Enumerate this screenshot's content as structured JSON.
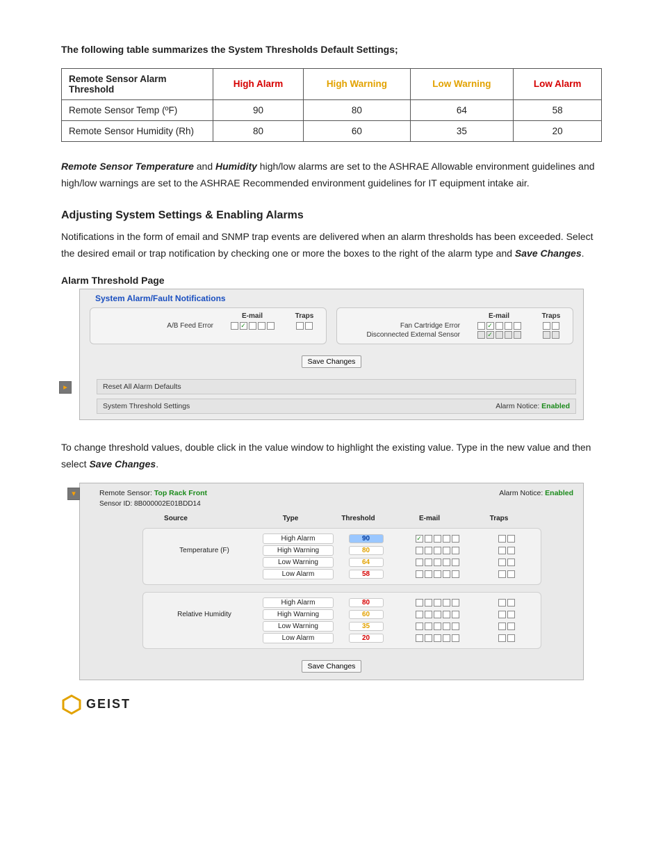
{
  "intro_line": "The following table summarizes the System Thresholds Default Settings;",
  "summary_table": {
    "headers": [
      "Remote Sensor Alarm Threshold",
      "High Alarm",
      "High Warning",
      "Low Warning",
      "Low Alarm"
    ],
    "rows": [
      {
        "label": "Remote Sensor Temp (ºF)",
        "ha": "90",
        "hw": "80",
        "lw": "64",
        "la": "58"
      },
      {
        "label": "Remote Sensor Humidity (Rh)",
        "ha": "80",
        "hw": "60",
        "lw": "35",
        "la": "20"
      }
    ]
  },
  "chart_data": {
    "type": "table",
    "title": "System Thresholds Default Settings",
    "columns": [
      "Remote Sensor Alarm Threshold",
      "High Alarm",
      "High Warning",
      "Low Warning",
      "Low Alarm"
    ],
    "rows": [
      [
        "Remote Sensor Temp (ºF)",
        90,
        80,
        64,
        58
      ],
      [
        "Remote Sensor Humidity (Rh)",
        80,
        60,
        35,
        20
      ]
    ]
  },
  "para1": {
    "b1": "Remote Sensor Temperature",
    "mid": " and ",
    "b2": "Humidity",
    "rest": " high/low alarms are set to the ASHRAE Allowable environment guidelines and high/low warnings are set to the ASHRAE Recommended environment guidelines for IT equipment intake air."
  },
  "section_heading": "Adjusting System Settings & Enabling Alarms",
  "para2": {
    "text": "Notifications in the form of email and SNMP trap events are delivered when an alarm thresholds has been exceeded.  Select the desired email or trap notification by checking one or more the boxes to the right of the alarm type and ",
    "b": "Save Changes",
    "tail": "."
  },
  "sub_heading": "Alarm Threshold Page",
  "notif_panel": {
    "title": "System Alarm/Fault Notifications",
    "col_email": "E-mail",
    "col_traps": "Traps",
    "left": {
      "rows": [
        "A/B Feed Error"
      ]
    },
    "right": {
      "rows": [
        "Fan Cartridge Error",
        "Disconnected External Sensor"
      ]
    },
    "save": "Save Changes",
    "bar1": "Reset All Alarm Defaults",
    "bar2_left": "System Threshold Settings",
    "bar2_right_label": "Alarm Notice: ",
    "bar2_right_value": "Enabled"
  },
  "para3": {
    "text": "To change threshold values, double click in the value window to highlight the existing value. Type in the new value and then select ",
    "b": "Save Changes",
    "tail": "."
  },
  "thr_panel": {
    "head_left_label": "Remote Sensor: ",
    "head_left_value": "Top Rack Front",
    "head_right_label": "Alarm Notice: ",
    "head_right_value": "Enabled",
    "sensor_id_label": "Sensor ID: ",
    "sensor_id_value": "8B000002E01BDD14",
    "cols": {
      "source": "Source",
      "type": "Type",
      "threshold": "Threshold",
      "email": "E-mail",
      "traps": "Traps"
    },
    "groups": [
      {
        "source": "Temperature (F)",
        "rows": [
          {
            "type": "High Alarm",
            "val": "90",
            "cls": "sel",
            "email_first_checked": true
          },
          {
            "type": "High Warning",
            "val": "80",
            "cls": "orange",
            "email_first_checked": false
          },
          {
            "type": "Low Warning",
            "val": "64",
            "cls": "orange",
            "email_first_checked": false
          },
          {
            "type": "Low Alarm",
            "val": "58",
            "cls": "red",
            "email_first_checked": false
          }
        ]
      },
      {
        "source": "Relative Humidity",
        "rows": [
          {
            "type": "High Alarm",
            "val": "80",
            "cls": "red",
            "email_first_checked": false
          },
          {
            "type": "High Warning",
            "val": "60",
            "cls": "orange",
            "email_first_checked": false
          },
          {
            "type": "Low Warning",
            "val": "35",
            "cls": "orange",
            "email_first_checked": false
          },
          {
            "type": "Low Alarm",
            "val": "20",
            "cls": "red",
            "email_first_checked": false
          }
        ]
      }
    ],
    "save": "Save Changes"
  },
  "logo_text": "GEIST"
}
